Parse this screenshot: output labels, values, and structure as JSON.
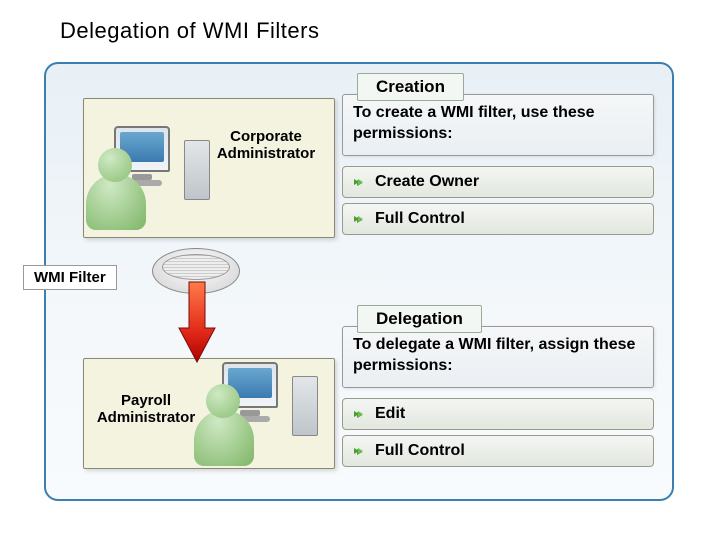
{
  "title": "Delegation of WMI Filters",
  "roles": {
    "corporate": "Corporate Administrator",
    "payroll": "Payroll Administrator"
  },
  "wmi_filter_label": "WMI Filter",
  "creation": {
    "heading": "Creation",
    "body": "To create a WMI filter, use these permissions:",
    "permissions": [
      "Create Owner",
      "Full Control"
    ]
  },
  "delegation": {
    "heading": "Delegation",
    "body": "To delegate a WMI filter, assign these permissions:",
    "permissions": [
      "Edit",
      "Full Control"
    ]
  },
  "icons": {
    "actor": "user-with-computer",
    "disk": "sieve-filter",
    "arrow": "red-down-arrow",
    "bullet": "green-arrow-bullet"
  }
}
